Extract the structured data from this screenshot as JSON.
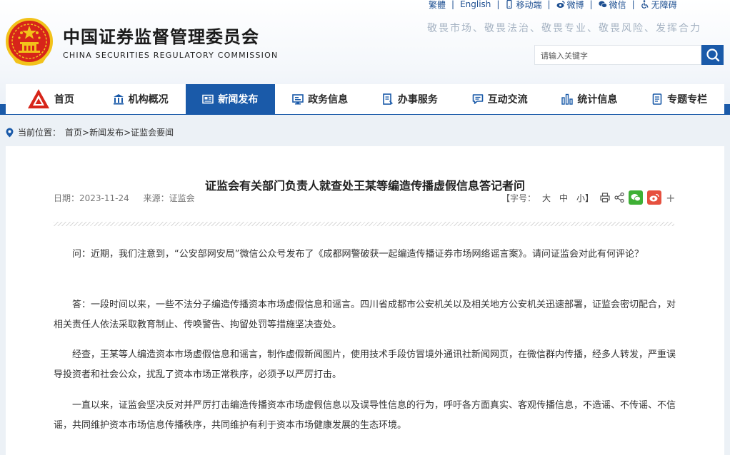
{
  "header": {
    "title_cn": "中国证券监督管理委员会",
    "title_en": "CHINA SECURITIES REGULATORY COMMISSION",
    "slogan": "敬畏市场、敬畏法治、敬畏专业、敬畏风险、发挥合力",
    "search_placeholder": "请输入关键字",
    "toplinks": {
      "lang_cn": "繁體",
      "lang_en": "English",
      "mobile": "移动端",
      "weibo": "微博",
      "wechat": "微信",
      "accessible": "无障碍"
    }
  },
  "nav": {
    "home": "首页",
    "about": "机构概况",
    "news": "新闻发布",
    "gov": "政务信息",
    "service": "办事服务",
    "interact": "互动交流",
    "stats": "统计信息",
    "topics": "专题专栏"
  },
  "breadcrumb": {
    "prefix": "当前位置：",
    "path": "首页>新闻发布>证监会要闻"
  },
  "article": {
    "title": "证监会有关部门负责人就查处王某等编造传播虚假信息答记者问",
    "date": "日期：2023-11-24",
    "source": "来源：证监会",
    "font_label": "【字号：",
    "size_large": "大",
    "size_medium": "中",
    "size_small": "小】",
    "paragraphs": [
      "问：近期，我们注意到，“公安部网安局”微信公众号发布了《成都网警破获一起编造传播证券市场网络谣言案》。请问证监会对此有何评论？",
      "答：一段时间以来，一些不法分子编造传播资本市场虚假信息和谣言。四川省成都市公安机关以及相关地方公安机关迅速部署，证监会密切配合，对相关责任人依法采取教育制止、传唤警告、拘留处罚等措施坚决查处。",
      "经查，王某等人编造资本市场虚假信息和谣言，制作虚假新闻图片，使用技术手段仿冒境外通讯社新闻网页，在微信群内传播，经多人转发，严重误导投资者和社会公众，扰乱了资本市场正常秩序，必须予以严厉打击。",
      "一直以来，证监会坚决反对并严厉打击编造传播资本市场虚假信息以及误导性信息的行为，呼吁各方面真实、客观传播信息，不造谣、不传谣、不信谣，共同维护资本市场信息传播秩序，共同维护有利于资本市场健康发展的生态环境。"
    ]
  },
  "colors": {
    "brand_blue": "#1a5aa9",
    "emblem_red": "#d7251a",
    "emblem_gold": "#f2c21a"
  }
}
